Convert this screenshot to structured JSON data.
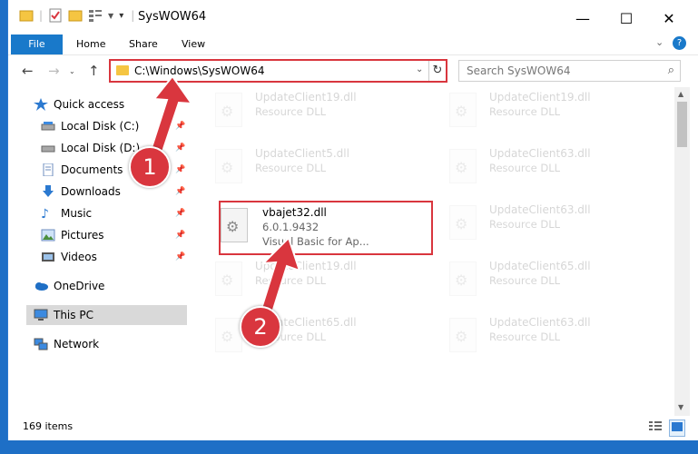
{
  "window": {
    "title": "SysWOW64",
    "controls": {
      "minimize": "—",
      "maximize": "☐",
      "close": "✕"
    }
  },
  "ribbon": {
    "file_tab": "File",
    "tabs": [
      "Home",
      "Share",
      "View"
    ]
  },
  "address_bar": {
    "path": "C:\\Windows\\SysWOW64",
    "refresh_icon": "refresh-icon"
  },
  "search": {
    "placeholder": "Search SysWOW64"
  },
  "nav_pane": {
    "items": [
      {
        "label": "Quick access",
        "icon": "star-icon",
        "pinned": false
      },
      {
        "label": "Local Disk (C:)",
        "icon": "drive-icon",
        "pinned": true
      },
      {
        "label": "Local Disk (D:)",
        "icon": "drive-icon",
        "pinned": true
      },
      {
        "label": "Documents",
        "icon": "documents-icon",
        "pinned": true
      },
      {
        "label": "Downloads",
        "icon": "downloads-icon",
        "pinned": true
      },
      {
        "label": "Music",
        "icon": "music-icon",
        "pinned": true
      },
      {
        "label": "Pictures",
        "icon": "pictures-icon",
        "pinned": true
      },
      {
        "label": "Videos",
        "icon": "videos-icon",
        "pinned": true
      },
      {
        "label": "OneDrive",
        "icon": "cloud-icon",
        "pinned": false
      },
      {
        "label": "This PC",
        "icon": "computer-icon",
        "pinned": false,
        "selected": true
      },
      {
        "label": "Network",
        "icon": "network-icon",
        "pinned": false
      }
    ]
  },
  "files": {
    "left_column": [
      {
        "name": "UpdateClient19.dll",
        "desc": "Resource DLL"
      },
      {
        "name": "UpdateClient5.dll",
        "desc": "Resource DLL"
      },
      {
        "name": "vbajet32.dll",
        "version": "6.0.1.9432",
        "desc": "Visual Basic for Ap...",
        "highlighted": true
      },
      {
        "name": "UpdateClient19.dll",
        "desc": "Resource DLL"
      },
      {
        "name": "UpdateClient65.dll",
        "desc": "Resource DLL"
      }
    ],
    "right_column": [
      {
        "name": "UpdateClient19.dll",
        "desc": "Resource DLL"
      },
      {
        "name": "UpdateClient63.dll",
        "desc": "Resource DLL"
      },
      {
        "name": "UpdateClient63.dll",
        "desc": "Resource DLL"
      },
      {
        "name": "UpdateClient65.dll",
        "desc": "Resource DLL"
      },
      {
        "name": "UpdateClient63.dll",
        "desc": "Resource DLL"
      }
    ]
  },
  "status_bar": {
    "item_count": "169 items"
  },
  "annotations": {
    "step1": "1",
    "step2": "2",
    "color": "#d9363e"
  }
}
